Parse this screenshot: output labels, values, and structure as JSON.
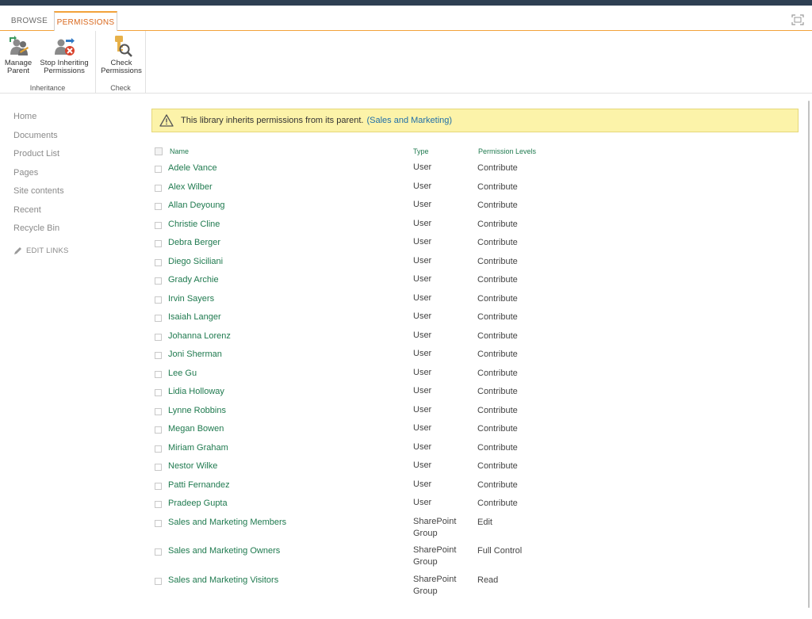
{
  "tabs": {
    "browse": "BROWSE",
    "permissions": "PERMISSIONS"
  },
  "ribbon": {
    "inheritance": {
      "label": "Inheritance",
      "manage_parent_line1": "Manage",
      "manage_parent_line2": "Parent",
      "stop_inheriting_line1": "Stop Inheriting",
      "stop_inheriting_line2": "Permissions"
    },
    "check": {
      "label": "Check",
      "check_line1": "Check",
      "check_line2": "Permissions"
    }
  },
  "nav": {
    "items": [
      "Home",
      "Documents",
      "Product List",
      "Pages",
      "Site contents",
      "Recent",
      "Recycle Bin"
    ],
    "edit_links": "EDIT LINKS"
  },
  "banner": {
    "message": "This library inherits permissions from its parent.",
    "parent_link": "(Sales and Marketing)"
  },
  "table": {
    "headers": {
      "name": "Name",
      "type": "Type",
      "permission_levels": "Permission Levels"
    },
    "rows": [
      {
        "name": "Adele Vance",
        "type": "User",
        "permission": "Contribute"
      },
      {
        "name": "Alex Wilber",
        "type": "User",
        "permission": "Contribute"
      },
      {
        "name": "Allan Deyoung",
        "type": "User",
        "permission": "Contribute"
      },
      {
        "name": "Christie Cline",
        "type": "User",
        "permission": "Contribute"
      },
      {
        "name": "Debra Berger",
        "type": "User",
        "permission": "Contribute"
      },
      {
        "name": "Diego Siciliani",
        "type": "User",
        "permission": "Contribute"
      },
      {
        "name": "Grady Archie",
        "type": "User",
        "permission": "Contribute"
      },
      {
        "name": "Irvin Sayers",
        "type": "User",
        "permission": "Contribute"
      },
      {
        "name": "Isaiah Langer",
        "type": "User",
        "permission": "Contribute"
      },
      {
        "name": "Johanna Lorenz",
        "type": "User",
        "permission": "Contribute"
      },
      {
        "name": "Joni Sherman",
        "type": "User",
        "permission": "Contribute"
      },
      {
        "name": "Lee Gu",
        "type": "User",
        "permission": "Contribute"
      },
      {
        "name": "Lidia Holloway",
        "type": "User",
        "permission": "Contribute"
      },
      {
        "name": "Lynne Robbins",
        "type": "User",
        "permission": "Contribute"
      },
      {
        "name": "Megan Bowen",
        "type": "User",
        "permission": "Contribute"
      },
      {
        "name": "Miriam Graham",
        "type": "User",
        "permission": "Contribute"
      },
      {
        "name": "Nestor Wilke",
        "type": "User",
        "permission": "Contribute"
      },
      {
        "name": "Patti Fernandez",
        "type": "User",
        "permission": "Contribute"
      },
      {
        "name": "Pradeep Gupta",
        "type": "User",
        "permission": "Contribute"
      },
      {
        "name": "Sales and Marketing Members",
        "type": "SharePoint Group",
        "permission": "Edit"
      },
      {
        "name": "Sales and Marketing Owners",
        "type": "SharePoint Group",
        "permission": "Full Control"
      },
      {
        "name": "Sales and Marketing Visitors",
        "type": "SharePoint Group",
        "permission": "Read"
      }
    ]
  },
  "colors": {
    "accent_orange": "#f2a23a",
    "link_green": "#1f7a4f",
    "banner_yellow": "#fcf3a9",
    "top_bar": "#2e3f52"
  },
  "icons": {
    "manage_parent": "manage-parent-icon",
    "stop_inheriting": "stop-inheriting-icon",
    "check_permissions": "check-permissions-icon",
    "warning": "warning-icon",
    "pencil": "pencil-icon",
    "focus": "focus-mode-icon"
  }
}
